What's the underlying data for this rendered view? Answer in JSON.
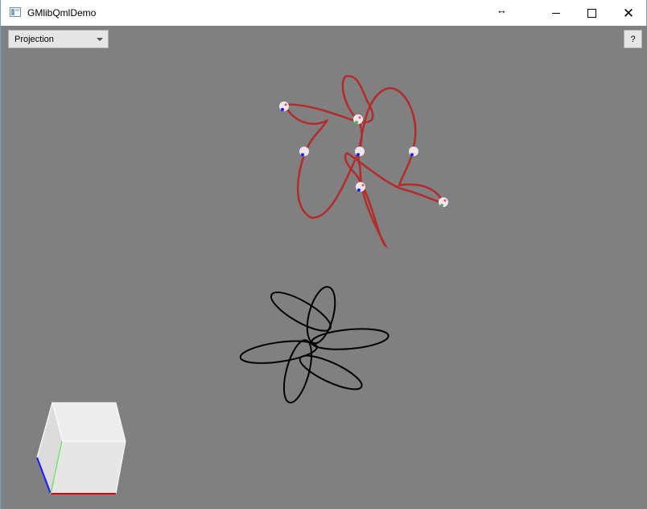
{
  "window": {
    "title": "GMlibQmlDemo"
  },
  "toolbar": {
    "projection_label": "Projection",
    "help_label": "?"
  },
  "scene": {
    "background_color": "#808080",
    "red_curve_color": "#b52a2a",
    "black_curve_color": "#000000",
    "nav_cube_face_color": "#e6e6e6",
    "axis_colors": {
      "x": "#e00000",
      "y": "#6ee06e",
      "z": "#1a1aff"
    }
  }
}
